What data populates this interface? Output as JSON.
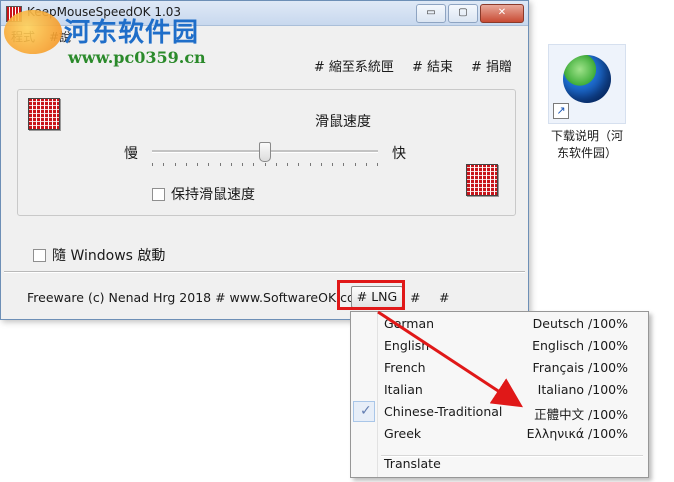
{
  "window": {
    "title": "KeepMouseSpeedOK 1.03",
    "min_label": "▭",
    "max_label": "▢",
    "close_label": "✕"
  },
  "menubar": {
    "item1": "程式",
    "item2": "#說"
  },
  "watermark": {
    "title": "河东软件园",
    "url": "www.pc0359.cn"
  },
  "toplinks": {
    "minimize": "# 縮至系統匣",
    "exit": "# 結束",
    "donate": "# 捐贈"
  },
  "controls": {
    "speed_label": "滑鼠速度",
    "slow": "慢",
    "fast": "快",
    "slider_value": 0.5,
    "keep_speed": "保持滑鼠速度",
    "startup": "隨 Windows 啟動"
  },
  "footer": {
    "text": "Freeware (c) Nenad Hrg 2018 # www.SoftwareOK.com",
    "lng": "# LNG",
    "hash1": "#",
    "hash2": "#"
  },
  "language_menu": {
    "items": [
      {
        "name": "German",
        "native": "Deutsch /100%",
        "checked": false
      },
      {
        "name": "English",
        "native": "Englisch /100%",
        "checked": false
      },
      {
        "name": "French",
        "native": "Français /100%",
        "checked": false
      },
      {
        "name": "Italian",
        "native": "Italiano /100%",
        "checked": false
      },
      {
        "name": "Chinese-Traditional",
        "native": "正體中文 /100%",
        "checked": true
      },
      {
        "name": "Greek",
        "native": "Ελληνικά /100%",
        "checked": false
      }
    ],
    "translate": "Translate",
    "check_mark": "✓"
  },
  "desktop_icon": {
    "caption_line1": "下载说明（河",
    "caption_line2": "东软件园）",
    "shortcut_glyph": "↗"
  },
  "colors": {
    "highlight": "#e01818",
    "arrow": "#e01818"
  }
}
